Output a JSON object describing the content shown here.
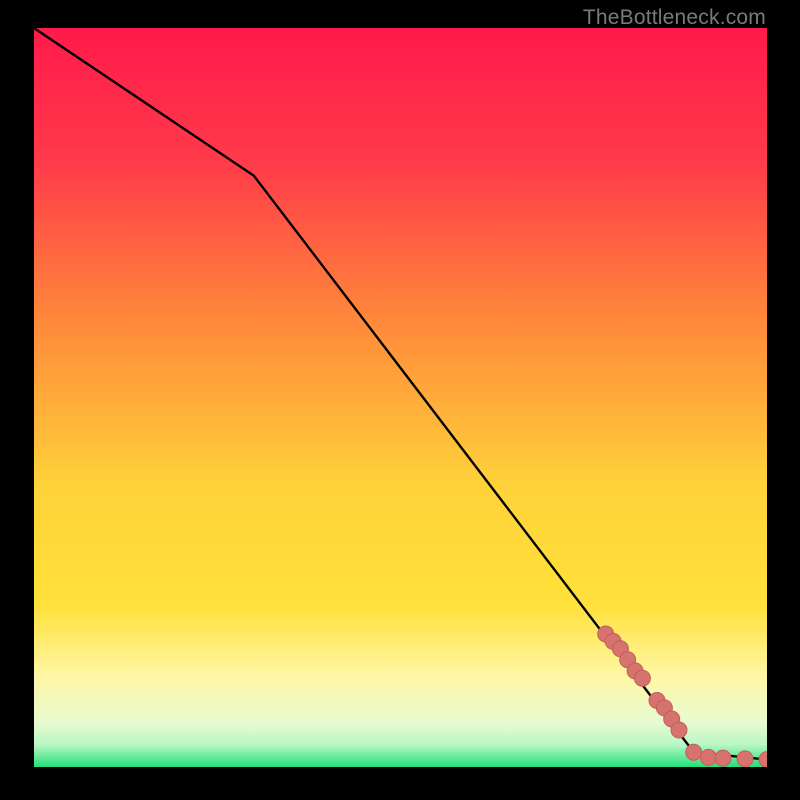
{
  "watermark": "TheBottleneck.com",
  "colors": {
    "page_bg": "#000000",
    "line": "#000000",
    "marker_fill": "#d6736f",
    "marker_stroke": "#c25f5b",
    "gradient_top": "#ff1a4b",
    "gradient_mid_orange": "#ff8a3a",
    "gradient_yellow": "#ffe13a",
    "gradient_pale_yellow": "#fff7a8",
    "gradient_pale_green": "#b8f7c4",
    "gradient_green": "#22e07a"
  },
  "chart_data": {
    "type": "line",
    "title": "",
    "xlabel": "",
    "ylabel": "",
    "xlim": [
      0,
      100
    ],
    "ylim": [
      0,
      100
    ],
    "line_points": [
      {
        "x": 0,
        "y": 100
      },
      {
        "x": 30,
        "y": 80
      },
      {
        "x": 90,
        "y": 2
      },
      {
        "x": 100,
        "y": 1
      }
    ],
    "markers": [
      {
        "x": 78,
        "y": 18
      },
      {
        "x": 79,
        "y": 17
      },
      {
        "x": 80,
        "y": 16
      },
      {
        "x": 81,
        "y": 14.5
      },
      {
        "x": 82,
        "y": 13
      },
      {
        "x": 83,
        "y": 12
      },
      {
        "x": 85,
        "y": 9
      },
      {
        "x": 86,
        "y": 8
      },
      {
        "x": 87,
        "y": 6.5
      },
      {
        "x": 88,
        "y": 5
      },
      {
        "x": 90,
        "y": 2
      },
      {
        "x": 92,
        "y": 1.3
      },
      {
        "x": 94,
        "y": 1.2
      },
      {
        "x": 97,
        "y": 1.1
      },
      {
        "x": 100,
        "y": 1
      }
    ],
    "marker_radius": 8
  }
}
